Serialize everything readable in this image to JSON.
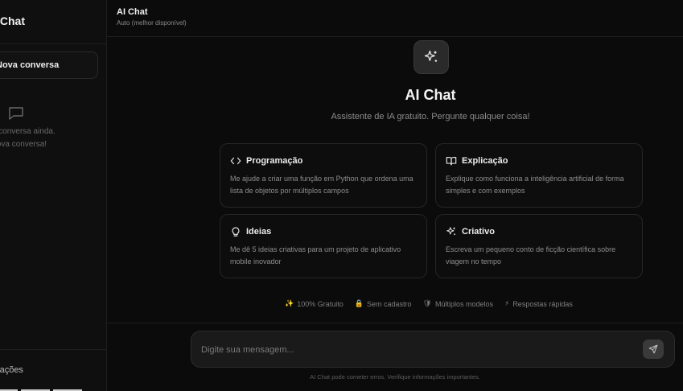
{
  "sidebar": {
    "brand": "AI Chat",
    "new_chat_label": "Nova conversa",
    "empty_line1": "Nenhuma conversa ainda.",
    "empty_line2": "Comece uma nova conversa!",
    "settings_label": "Configurações"
  },
  "header": {
    "title": "AI Chat",
    "subtitle": "Auto (melhor disponível)"
  },
  "hero": {
    "title": "AI Chat",
    "subtitle": "Assistente de IA gratuito. Pergunte qualquer coisa!"
  },
  "cards": [
    {
      "title": "Programação",
      "icon": "code-icon",
      "description": "Me ajude a criar uma função em Python que ordena uma lista de objetos por múltiplos campos"
    },
    {
      "title": "Explicação",
      "icon": "book-open-icon",
      "description": "Explique como funciona a inteligência artificial de forma simples e com exemplos"
    },
    {
      "title": "Ideias",
      "icon": "lightbulb-icon",
      "description": "Me dê 5 ideias criativas para um projeto de aplicativo mobile inovador"
    },
    {
      "title": "Criativo",
      "icon": "sparkles-icon",
      "description": "Escreva um pequeno conto de ficção científica sobre viagem no tempo"
    }
  ],
  "features": [
    {
      "emoji": "✨",
      "label": "100% Gratuito"
    },
    {
      "emoji": "🔒",
      "label": "Sem cadastro"
    },
    {
      "emoji": "🛡",
      "label": "Múltiplos modelos"
    },
    {
      "emoji": "⚡",
      "label": "Respostas rápidas"
    }
  ],
  "input": {
    "placeholder": "Digite sua mensagem...",
    "value": ""
  },
  "footnote": "AI Chat pode cometer erros. Verifique informações importantes.",
  "colors": {
    "background": "#0b0b0b",
    "sidebar": "#0f0f0f",
    "card_border": "#262626",
    "text_primary": "#f2f2f2",
    "text_muted": "#8c8c8c"
  }
}
